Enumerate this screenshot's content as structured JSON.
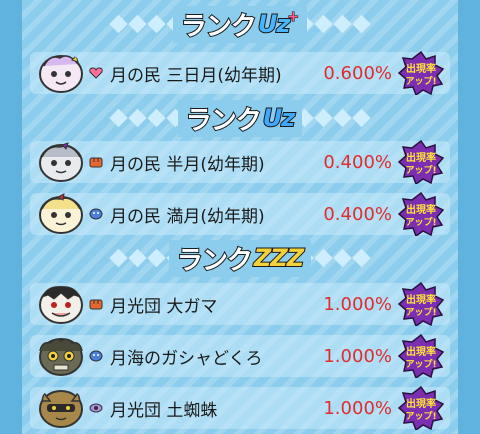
{
  "sections": [
    {
      "rank_word": "ランク",
      "rank_badge": "Uz",
      "rank_suffix": "+",
      "rows": [
        {
          "name": "月の民 三日月(幼年期)",
          "rate": "0.600%",
          "tribe_icon": "heart-icon",
          "badge_text": "出現率アップ!"
        }
      ]
    },
    {
      "rank_word": "ランク",
      "rank_badge": "Uz",
      "rows": [
        {
          "name": "月の民 半月(幼年期)",
          "rate": "0.400%",
          "tribe_icon": "fist-icon",
          "badge_text": "出現率アップ!"
        },
        {
          "name": "月の民 満月(幼年期)",
          "rate": "0.400%",
          "tribe_icon": "blob-icon",
          "badge_text": "出現率アップ!"
        }
      ]
    },
    {
      "rank_word": "ランク",
      "rank_badge": "ZZZ",
      "rows": [
        {
          "name": "月光団 大ガマ",
          "rate": "1.000%",
          "tribe_icon": "fist-icon",
          "badge_text": "出現率アップ!"
        },
        {
          "name": "月海のガシャどくろ",
          "rate": "1.000%",
          "tribe_icon": "blob-icon",
          "badge_text": "出現率アップ!"
        },
        {
          "name": "月光団 土蜘蛛",
          "rate": "1.000%",
          "tribe_icon": "eye-icon",
          "badge_text": "出現率アップ!"
        }
      ]
    }
  ],
  "colors": {
    "background": "#8ccdee",
    "rate_text": "#e02d2d",
    "badge_fill": "#7b2fb0",
    "badge_text": "#ffe23a"
  }
}
